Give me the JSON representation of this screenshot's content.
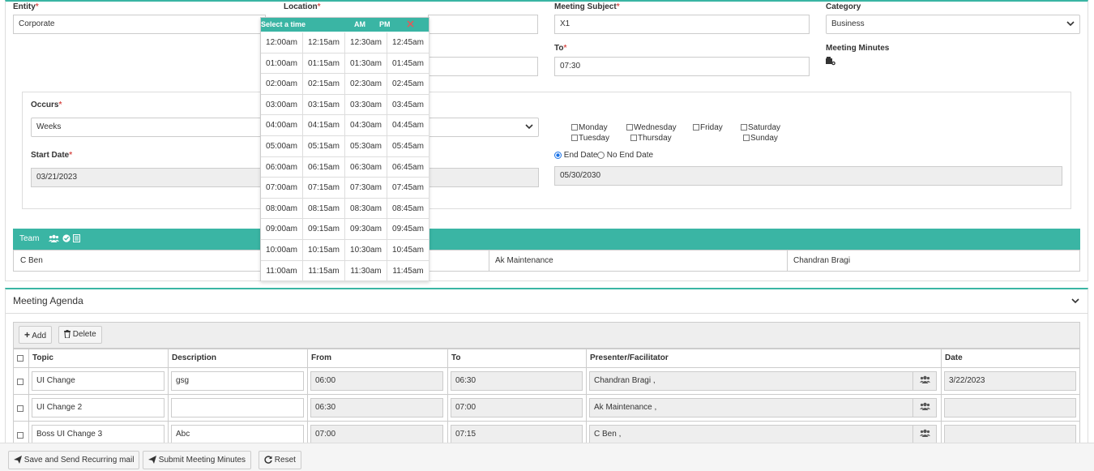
{
  "form": {
    "entity_label": "Entity",
    "entity_value": "Corporate",
    "location_label": "Location",
    "meeting_subject_label": "Meeting Subject",
    "meeting_subject_value": "X1",
    "category_label": "Category",
    "category_value": "Business",
    "to_label": "To",
    "to_value": "07:30",
    "meeting_minutes_label": "Meeting Minutes",
    "required_mark": "*"
  },
  "recurrence": {
    "occurs_label": "Occurs",
    "occurs_value": "Weeks",
    "start_date_label": "Start Date",
    "start_date_value": "03/21/2023",
    "days": [
      "Monday",
      "Wednesday",
      "Friday",
      "Saturday",
      "Tuesday",
      "Thursday",
      "Sunday"
    ],
    "end_date_option": "End Date",
    "no_end_date_option": "No End Date",
    "end_date_value": "05/30/2030",
    "end_date_selected": true
  },
  "time_picker": {
    "title": "Select a time",
    "am_label": "AM",
    "pm_label": "PM",
    "times": [
      [
        "12:00am",
        "12:15am",
        "12:30am",
        "12:45am"
      ],
      [
        "01:00am",
        "01:15am",
        "01:30am",
        "01:45am"
      ],
      [
        "02:00am",
        "02:15am",
        "02:30am",
        "02:45am"
      ],
      [
        "03:00am",
        "03:15am",
        "03:30am",
        "03:45am"
      ],
      [
        "04:00am",
        "04:15am",
        "04:30am",
        "04:45am"
      ],
      [
        "05:00am",
        "05:15am",
        "05:30am",
        "05:45am"
      ],
      [
        "06:00am",
        "06:15am",
        "06:30am",
        "06:45am"
      ],
      [
        "07:00am",
        "07:15am",
        "07:30am",
        "07:45am"
      ],
      [
        "08:00am",
        "08:15am",
        "08:30am",
        "08:45am"
      ],
      [
        "09:00am",
        "09:15am",
        "09:30am",
        "09:45am"
      ],
      [
        "10:00am",
        "10:15am",
        "10:30am",
        "10:45am"
      ],
      [
        "11:00am",
        "11:15am",
        "11:30am",
        "11:45am"
      ]
    ]
  },
  "team": {
    "label": "Team",
    "members": [
      "C Ben",
      "Ak Maintenance",
      "Chandran Bragi"
    ]
  },
  "agenda": {
    "title": "Meeting Agenda",
    "add_label": "Add",
    "delete_label": "Delete",
    "columns": [
      "Topic",
      "Description",
      "From",
      "To",
      "Presenter/Facilitator",
      "Date"
    ],
    "rows": [
      {
        "topic": "UI Change",
        "description": "gsg",
        "from": "06:00",
        "to": "06:30",
        "presenter": "Chandran Bragi ,",
        "date": "3/22/2023"
      },
      {
        "topic": "UI Change 2",
        "description": "",
        "from": "06:30",
        "to": "07:00",
        "presenter": "Ak Maintenance ,",
        "date": ""
      },
      {
        "topic": "Boss UI Change 3",
        "description": "Abc",
        "from": "07:00",
        "to": "07:15",
        "presenter": "C Ben ,",
        "date": ""
      }
    ]
  },
  "footer": {
    "save_send_label": "Save and Send Recurring mail",
    "submit_minutes_label": "Submit Meeting Minutes",
    "reset_label": "Reset"
  },
  "colors": {
    "accent": "#3ab5a4",
    "required": "#d9534f",
    "readonly_bg": "#eeeeee"
  }
}
